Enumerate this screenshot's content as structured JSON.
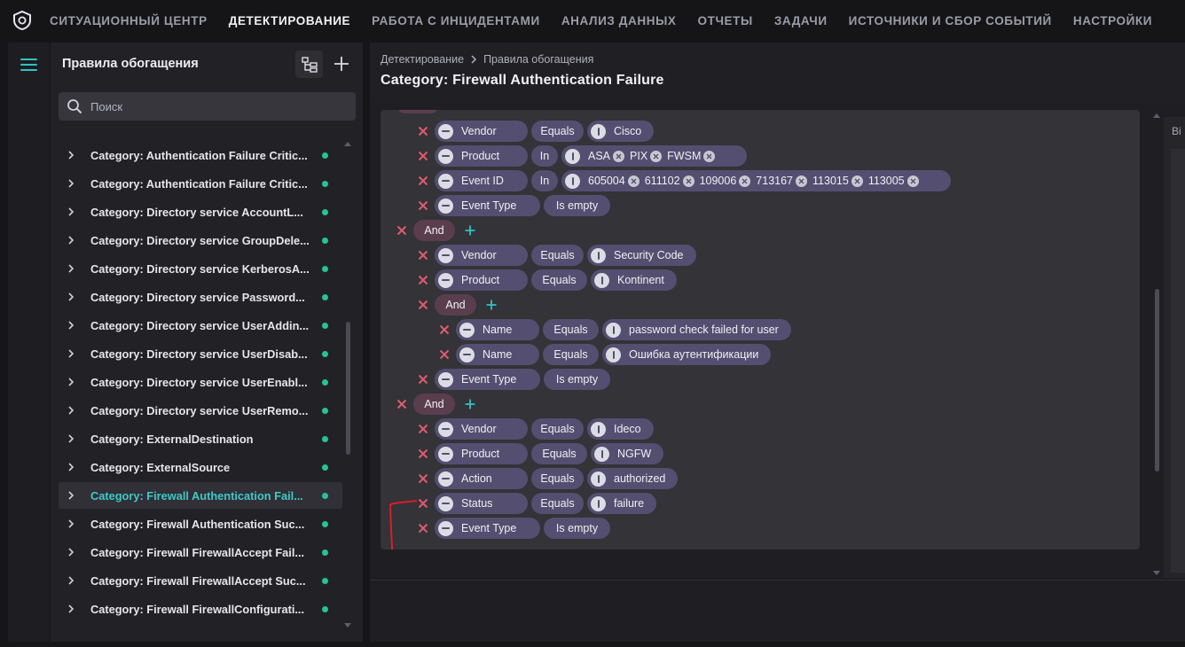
{
  "colors": {
    "accent": "#2ec4c4",
    "status_dot": "#27c29a",
    "remove": "#e05a6e",
    "pill": "#544e70",
    "group_pill": "#5a3e4e",
    "annotation": "#d81e2a"
  },
  "topnav": {
    "items": [
      "СИТУАЦИОННЫЙ ЦЕНТР",
      "ДЕТЕКТИРОВАНИЕ",
      "РАБОТА С ИНЦИДЕНТАМИ",
      "АНАЛИЗ ДАННЫХ",
      "ОТЧЕТЫ",
      "ЗАДАЧИ",
      "ИСТОЧНИКИ И СБОР СОБЫТИЙ",
      "НАСТРОЙКИ"
    ],
    "active_index": 1
  },
  "sidebar": {
    "title": "Правила обогащения",
    "search_placeholder": "Поиск",
    "items": [
      "Category: Authentication Failure Critic...",
      "Category: Authentication Failure Critic...",
      "Category: Directory service AccountL...",
      "Category: Directory service GroupDele...",
      "Category: Directory service KerberosA...",
      "Category: Directory service Password...",
      "Category: Directory service UserAddin...",
      "Category: Directory service UserDisab...",
      "Category: Directory service UserEnabl...",
      "Category: Directory service UserRemo...",
      "Category: ExternalDestination",
      "Category: ExternalSource",
      "Category: Firewall Authentication Fail...",
      "Category: Firewall Authentication Suc...",
      "Category: Firewall FirewallAccept Fail...",
      "Category: Firewall FirewallAccept Suc...",
      "Category: Firewall FirewallConfigurati..."
    ],
    "selected_index": 12
  },
  "main": {
    "breadcrumb": [
      "Детектирование",
      "Правила обогащения"
    ],
    "title": "Category: Firewall Authentication Failure",
    "right_label": "Ві",
    "conditions": [
      {
        "depth": 1,
        "field": "Vendor",
        "op": "Equals",
        "value": "Cisco"
      },
      {
        "depth": 1,
        "field": "Product",
        "op": "In",
        "values": [
          "ASA",
          "PIX",
          "FWSM"
        ]
      },
      {
        "depth": 1,
        "field": "Event ID",
        "op": "In",
        "values": [
          "605004",
          "611102",
          "109006",
          "713167",
          "113015",
          "113005"
        ]
      },
      {
        "depth": 1,
        "field": "Event Type",
        "op": "Is empty"
      },
      {
        "depth": 0,
        "group": "And"
      },
      {
        "depth": 1,
        "field": "Vendor",
        "op": "Equals",
        "value": "Security Code"
      },
      {
        "depth": 1,
        "field": "Product",
        "op": "Equals",
        "value": "Kontinent"
      },
      {
        "depth": 1,
        "group": "And"
      },
      {
        "depth": 2,
        "field": "Name",
        "op": "Equals",
        "value": "password check failed for user"
      },
      {
        "depth": 2,
        "field": "Name",
        "op": "Equals",
        "value": "Ошибка аутентификации"
      },
      {
        "depth": 1,
        "field": "Event Type",
        "op": "Is empty"
      },
      {
        "depth": 0,
        "group": "And"
      },
      {
        "depth": 1,
        "field": "Vendor",
        "op": "Equals",
        "value": "Ideco"
      },
      {
        "depth": 1,
        "field": "Product",
        "op": "Equals",
        "value": "NGFW"
      },
      {
        "depth": 1,
        "field": "Action",
        "op": "Equals",
        "value": "authorized"
      },
      {
        "depth": 1,
        "field": "Status",
        "op": "Equals",
        "value": "failure"
      },
      {
        "depth": 1,
        "field": "Event Type",
        "op": "Is empty"
      }
    ]
  }
}
